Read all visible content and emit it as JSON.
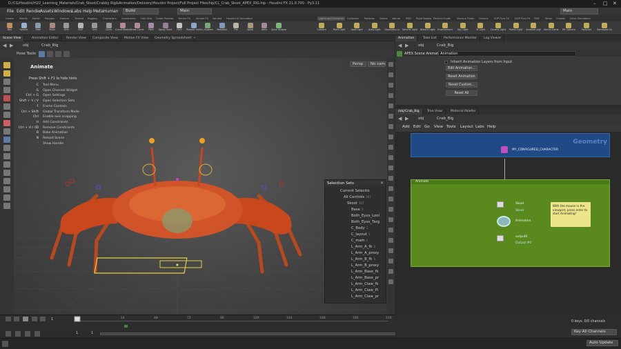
{
  "window": {
    "title": "D:/CG/Houdini/H22_Learning_Materials/Crab_Skoot/Crabby Rig&Animation/Delivery/Houdini Project/Full Project Files/hip/CL_Crab_Skoot_APEX_RIG.hip - Houdini FX 21.0.700 - Py3.11"
  },
  "menubar": {
    "items": [
      "File",
      "Edit",
      "Render",
      "Assets",
      "Windows",
      "Labs",
      "Help",
      "MetaHuman"
    ],
    "build": "Build",
    "desktop_left": "Main",
    "desktop_right": "Main"
  },
  "shelf_tabs_left": [
    "Create",
    "Modify",
    "Model",
    "Polygon",
    "Deform",
    "Texture",
    "Rigging",
    "Characters",
    "Constraints",
    "Hair Utils",
    "Guide Process",
    "Terrain FX",
    "Simple FX",
    "Volume",
    "Houdini AI Animation"
  ],
  "shelf_tabs_right": [
    "Lights and Cameras",
    "Collisions",
    "Particles",
    "Grains",
    "Vellum",
    "RBD",
    "Rigid Bodies",
    "Particle Fluids",
    "Viscous Fluids",
    "Oceans",
    "SOP Pyro FX",
    "DOP Pyro FX",
    "FEM",
    "Wires",
    "Crowds",
    "Drive Simulation"
  ],
  "shelf_tools_left": [
    "Box",
    "Sphere",
    "Tube",
    "Torus",
    "Grid",
    "Null",
    "Line",
    "Circle",
    "Curve Bezier",
    "Draw Curve",
    "Path",
    "Spray Paint",
    "Font",
    "Platonic Solids",
    "L-System",
    "Metaball",
    "File",
    "Spiral",
    "Helix",
    "Quick Shapes"
  ],
  "shelf_tools_right": [
    "Camera",
    "Point Light",
    "Spot Light",
    "Area Light",
    "Geometry Light",
    "Volume Light",
    "Distant Light",
    "Environment Light",
    "Sky Light",
    "GI Light",
    "Caustic Light",
    "Portal Light",
    "Ambient Light",
    "Stereo Camera",
    "VR Camera",
    "Switcher",
    "Gamepad Camera"
  ],
  "left_pane_tabs": [
    "Scene View",
    "Animation Editor",
    "Render View",
    "Composite View",
    "Motion FX View",
    "Geometry Spreadsheet"
  ],
  "viewport": {
    "path_obj": "obj",
    "path_node": "Crab_Big",
    "tools_label": "Pose Tools",
    "persp": "Persp",
    "cam": "No cam",
    "hints_title": "Animate",
    "hints_header": "Press Shift + F1 to hide hints",
    "hints": [
      {
        "k": "C",
        "d": "Tool Menu"
      },
      {
        "k": "G",
        "d": "Open Channel Widget"
      },
      {
        "k": "Ctrl + G",
        "d": "Open Settings"
      },
      {
        "k": "Shift + V / V",
        "d": "Open Selection Sets"
      },
      {
        "k": "F",
        "d": "Frame Controls"
      },
      {
        "k": "Ctrl + Shift",
        "d": "Global Transform Mode"
      },
      {
        "k": "Ctrl",
        "d": "Enable axis snapping"
      },
      {
        "k": "H",
        "d": "Add Constraints"
      },
      {
        "k": "Ctrl + H / ⌫",
        "d": "Remove Constraints"
      },
      {
        "k": "B",
        "d": "Bake Animation"
      },
      {
        "k": "N",
        "d": "Reload Scene"
      },
      {
        "k": "`",
        "d": "Show Handle"
      }
    ]
  },
  "selection_sets": {
    "title": "Selection Sets",
    "rows": [
      {
        "label": "Current Selectio",
        "count": ""
      },
      {
        "label": "All Controls",
        "count": "167"
      },
      {
        "label": "Skoot",
        "count": "167"
      },
      {
        "label": "Base",
        "count": "1"
      },
      {
        "label": "Both_Eyes_Lool",
        "count": ""
      },
      {
        "label": "Both_Eyes_Targ",
        "count": ""
      },
      {
        "label": "C_Body",
        "count": "1"
      },
      {
        "label": "C_layout",
        "count": "1"
      },
      {
        "label": "C_main",
        "count": "1"
      },
      {
        "label": "L_Arm_A_fk",
        "count": "3"
      },
      {
        "label": "L_Arm_A_proxy",
        "count": ""
      },
      {
        "label": "L_Arm_B_fk",
        "count": "3"
      },
      {
        "label": "L_Arm_B_proxy",
        "count": ""
      },
      {
        "label": "L_Arm_Base_fk",
        "count": ""
      },
      {
        "label": "L_Arm_Base_pr",
        "count": ""
      },
      {
        "label": "L_Arm_Claw_fk",
        "count": ""
      },
      {
        "label": "L_Arm_Claw_Pi",
        "count": ""
      },
      {
        "label": "L_Arm_Claw_pr",
        "count": ""
      }
    ]
  },
  "timeline": {
    "frame": "1",
    "ticks": [
      "24",
      "48",
      "72",
      "96",
      "120",
      "144",
      "168",
      "192",
      "216"
    ],
    "start": "1",
    "start2": "1",
    "end": "239",
    "end2": "239"
  },
  "right_top": {
    "tabs": [
      "Animation",
      "Take List",
      "Performance Monitor",
      "Log Viewer"
    ],
    "path_obj": "obj",
    "path_node": "Crab_Big",
    "node_type": "APEX Scene Animate",
    "node_name": "Animation",
    "inherit_label": "Inherit Animation Layers from Input",
    "buttons": [
      "Edit Animation...",
      "Reset Animation",
      "Reset Custom...",
      "Reset All"
    ]
  },
  "network": {
    "tabs": [
      "/obj/Crab_Big",
      "Tree View",
      "Material Palette"
    ],
    "path_obj": "obj",
    "path_node": "Crab_Big",
    "menu": [
      "Add",
      "Edit",
      "Go",
      "View",
      "Tools",
      "Layout",
      "Labs",
      "Help"
    ],
    "geometry_label": "Geometry",
    "configured_node": "MY_CONFIGURED_CHARACTER",
    "animate_label": "Animate",
    "skoot_label": "Skoot",
    "skoot_sub": "Skoot",
    "anim_node": "Animation",
    "anim_sub": "",
    "output_node": "output0",
    "output_sub": "Output #0",
    "note": "With the mouse in the viewport, press enter to start Animating!"
  },
  "right_bottom": {
    "keys": "0 keys, 0/0 channels",
    "key_all": "Key All Channels",
    "auto_update": "Auto Update"
  }
}
